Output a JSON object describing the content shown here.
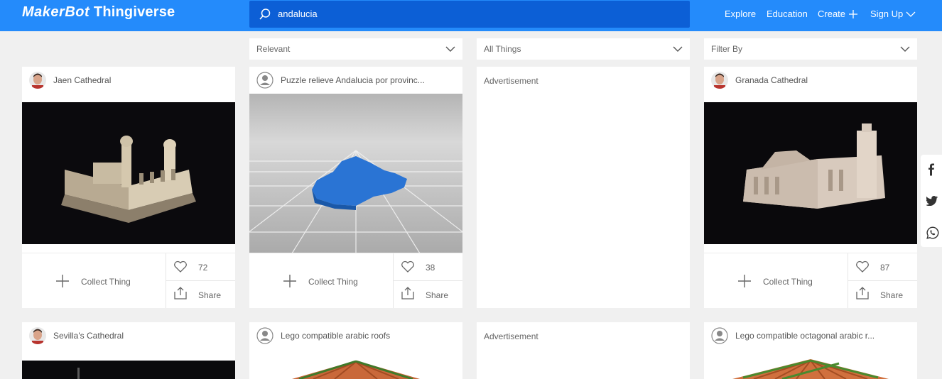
{
  "brand": {
    "part1": "MakerBot",
    "part2": "Thingiverse"
  },
  "search": {
    "query": "andalucia"
  },
  "nav": {
    "explore": "Explore",
    "education": "Education",
    "create": "Create",
    "signup": "Sign Up"
  },
  "filters": {
    "sort": "Relevant",
    "type": "All Things",
    "filter": "Filter By"
  },
  "cards": [
    {
      "title": "Jaen Cathedral",
      "collect": "Collect Thing",
      "likes": "72",
      "share": "Share"
    },
    {
      "title": "Puzzle relieve Andalucia por provinc...",
      "collect": "Collect Thing",
      "likes": "38",
      "share": "Share"
    },
    {
      "title": "Granada Cathedral",
      "collect": "Collect Thing",
      "likes": "87",
      "share": "Share"
    },
    {
      "title": "Sevilla's Cathedral"
    },
    {
      "title": "Lego compatible arabic roofs"
    },
    {
      "title": "Lego compatible octagonal arabic r..."
    }
  ],
  "ads": {
    "label": "Advertisement"
  },
  "social": [
    "facebook-icon",
    "twitter-icon",
    "whatsapp-icon"
  ],
  "colors": {
    "header": "#248bfb",
    "search": "#0c5fd6",
    "background": "#f0f0f0"
  }
}
